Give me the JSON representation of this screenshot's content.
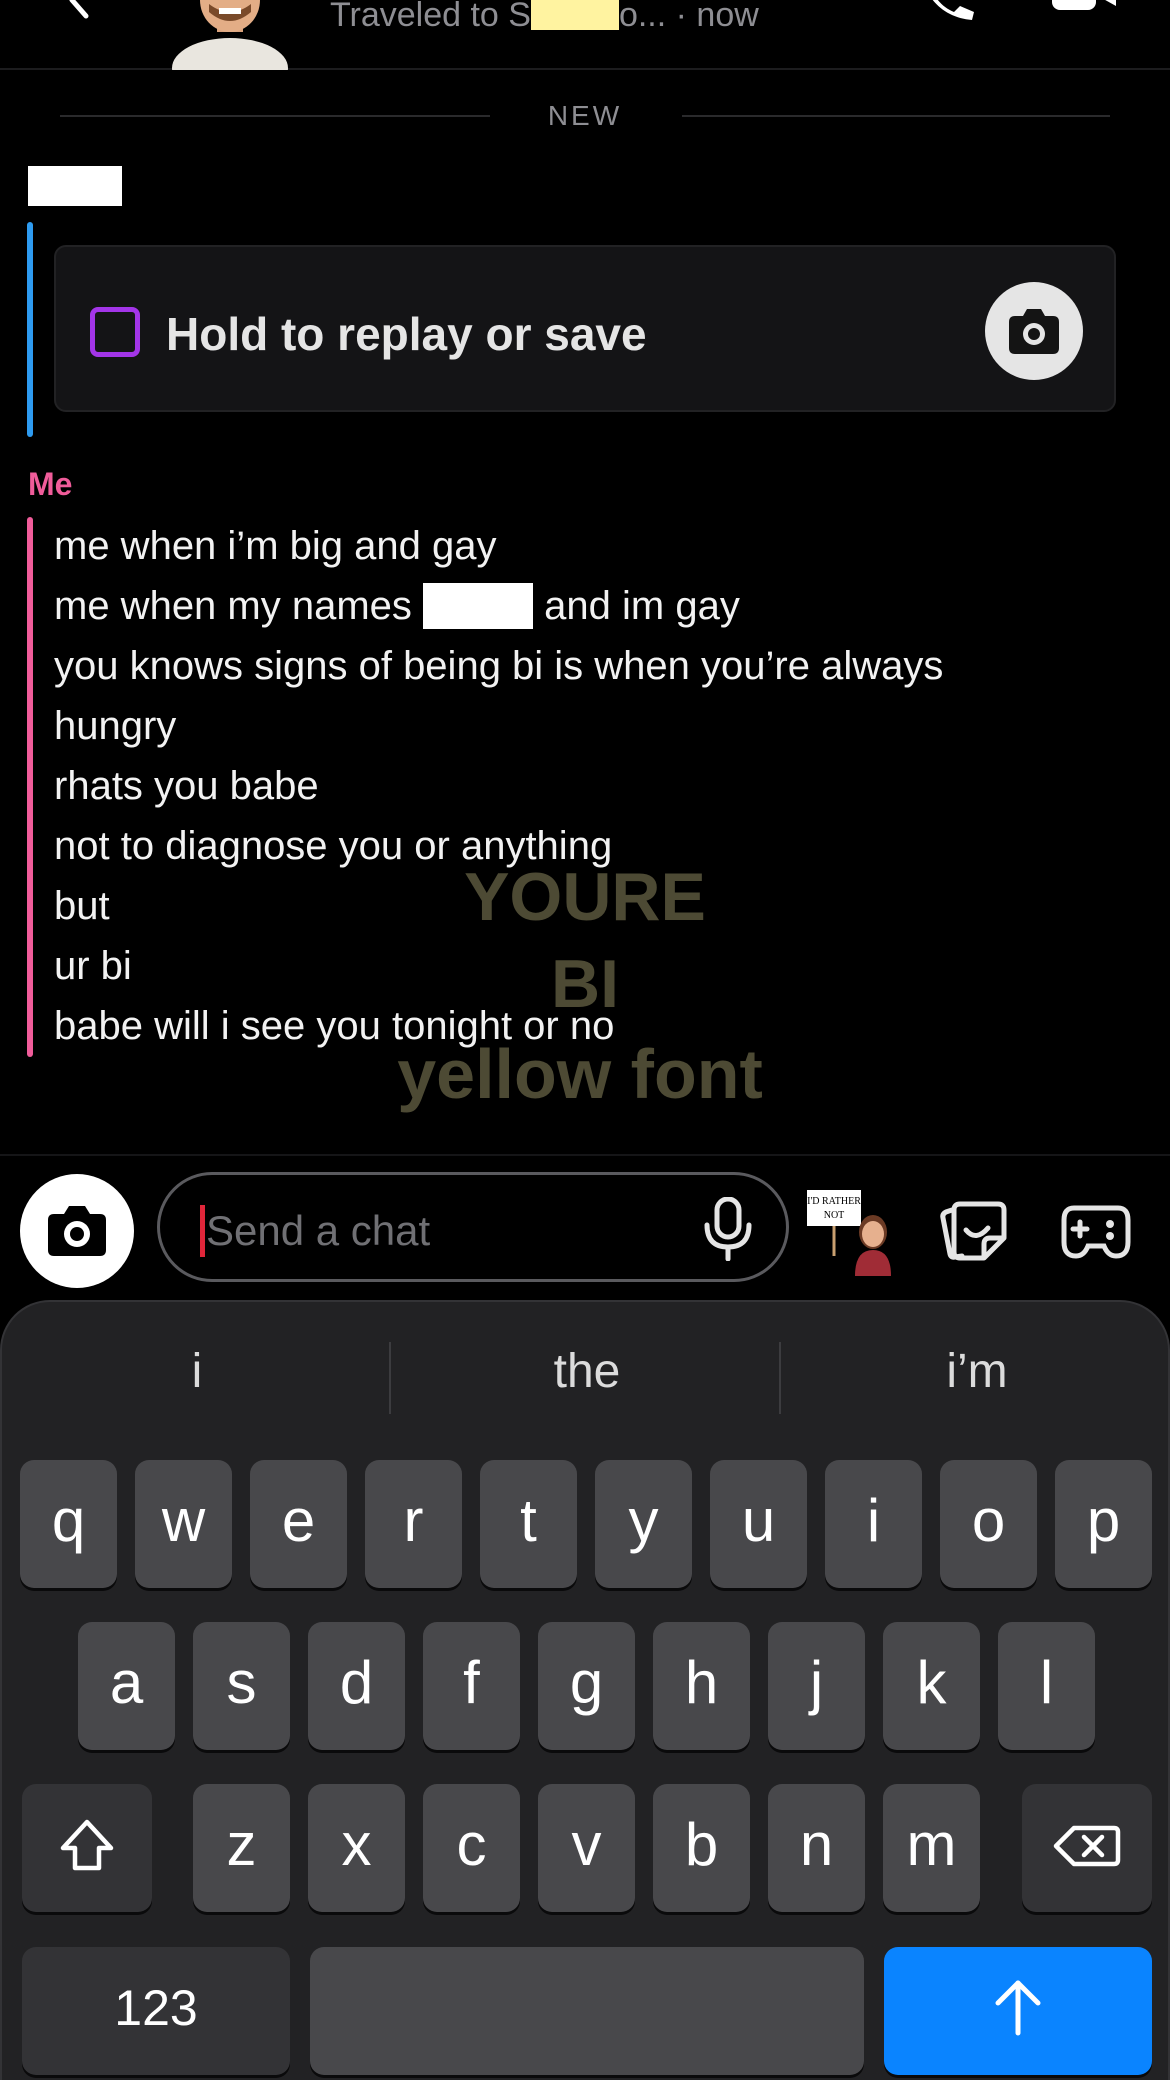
{
  "header": {
    "status_prefix": "Traveled to S",
    "status_suffix": "o... · now"
  },
  "divider": {
    "label": "NEW"
  },
  "snap": {
    "text": "Hold to replay or save"
  },
  "me": {
    "label": "Me",
    "messages": [
      "me when i’m big and gay",
      "me when my names",
      "you knows signs of being bi is when you’re always",
      "hungry",
      "rhats you babe",
      "not to diagnose you or anything",
      "but",
      "ur bi",
      "babe will i see you tonight or no"
    ],
    "message2_suffix": "and im gay"
  },
  "overlay": {
    "line1": "YOURE",
    "line2": "BI",
    "line3": "yellow font"
  },
  "input": {
    "placeholder": "Send a chat"
  },
  "sticker": {
    "text_line1": "I'D RATHER",
    "text_line2": "NOT"
  },
  "keyboard": {
    "suggestions": [
      "i",
      "the",
      "i’m"
    ],
    "row1": [
      "q",
      "w",
      "e",
      "r",
      "t",
      "y",
      "u",
      "i",
      "o",
      "p"
    ],
    "row2": [
      "a",
      "s",
      "d",
      "f",
      "g",
      "h",
      "j",
      "k",
      "l"
    ],
    "row3": [
      "z",
      "x",
      "c",
      "v",
      "b",
      "n",
      "m"
    ],
    "numbers_label": "123"
  },
  "colors": {
    "friend_accent": "#2e9bf0",
    "me_accent": "#f05c9a",
    "snap_square": "#a335e8",
    "send_key": "#0a84ff",
    "overlay_text": "#4d4a34"
  }
}
